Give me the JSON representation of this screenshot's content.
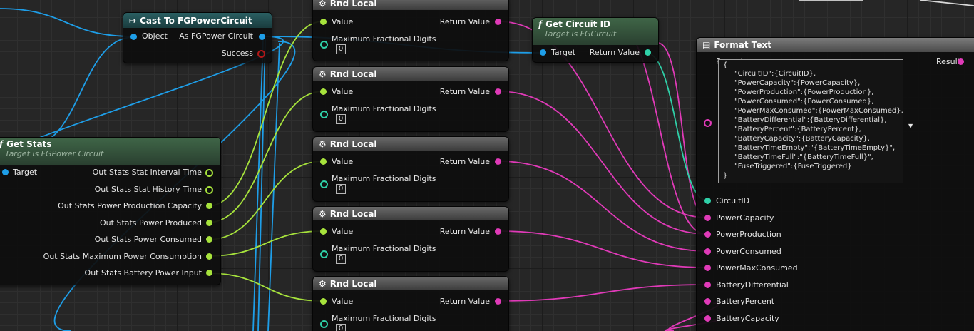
{
  "nodes": {
    "cast": {
      "title": "Cast To FGPowerCircuit",
      "input_object": "Object",
      "output_as": "As FGPower Circuit",
      "output_success": "Success"
    },
    "get_stats": {
      "title": "Get Stats",
      "subtitle": "Target is FGPower Circuit",
      "input_target": "Target",
      "outputs": [
        "Out Stats Stat Interval Time",
        "Out Stats Stat History Time",
        "Out Stats Power Production Capacity",
        "Out Stats Power Produced",
        "Out Stats Power Consumed",
        "Out Stats Maximum Power Consumption",
        "Out Stats Battery Power Input"
      ]
    },
    "rnd_local": [
      {
        "title": "Rnd Local",
        "value": "Value",
        "return_value": "Return Value",
        "max_digits": "Maximum Fractional Digits",
        "digits_value": "0"
      },
      {
        "title": "Rnd Local",
        "value": "Value",
        "return_value": "Return Value",
        "max_digits": "Maximum Fractional Digits",
        "digits_value": "0"
      },
      {
        "title": "Rnd Local",
        "value": "Value",
        "return_value": "Return Value",
        "max_digits": "Maximum Fractional Digits",
        "digits_value": "0"
      },
      {
        "title": "Rnd Local",
        "value": "Value",
        "return_value": "Return Value",
        "max_digits": "Maximum Fractional Digits",
        "digits_value": "0"
      },
      {
        "title": "Rnd Local",
        "value": "Value",
        "return_value": "Return Value",
        "max_digits": "Maximum Fractional Digits",
        "digits_value": "0"
      }
    ],
    "get_circuit_id": {
      "title": "Get Circuit ID",
      "subtitle": "Target is FGCircuit",
      "input_target": "Target",
      "output_return": "Return Value"
    },
    "format_text": {
      "title": "Format Text",
      "format_label": "Format",
      "result_label": "Result",
      "format_lines": [
        "{",
        "\"CircuitID\":{CircuitID},",
        "\"PowerCapacity\":{PowerCapacity},",
        "\"PowerProduction\":{PowerProduction},",
        "\"PowerConsumed\":{PowerConsumed},",
        "\"PowerMaxConsumed\":{PowerMaxConsumed},",
        "\"BatteryDifferential\":{BatteryDifferential},",
        "\"BatteryPercent\":{BatteryPercent},",
        "\"BatteryCapacity\":{BatteryCapacity},",
        "\"BatteryTimeEmpty\":\"{BatteryTimeEmpty}\",",
        "\"BatteryTimeFull\":\"{BatteryTimeFull}\",",
        "\"FuseTriggered\":{FuseTriggered}",
        "}"
      ],
      "inputs": [
        "CircuitID",
        "PowerCapacity",
        "PowerProduction",
        "PowerConsumed",
        "PowerMaxConsumed",
        "BatteryDifferential",
        "BatteryPercent",
        "BatteryCapacity"
      ]
    }
  },
  "colors": {
    "object_pin": "#1e9ee8",
    "float_pin": "#a7e33c",
    "text_pin": "#e03ab8",
    "int_pin": "#2fd0a8",
    "bool_pin": "#b01818",
    "exec_icon": "#ffffff"
  },
  "icons": {
    "cast": "cast-arrow-icon",
    "func": "function-icon",
    "macro": "macro-icon",
    "format": "format-text-icon",
    "dropdown": "dropdown-arrow-icon"
  }
}
